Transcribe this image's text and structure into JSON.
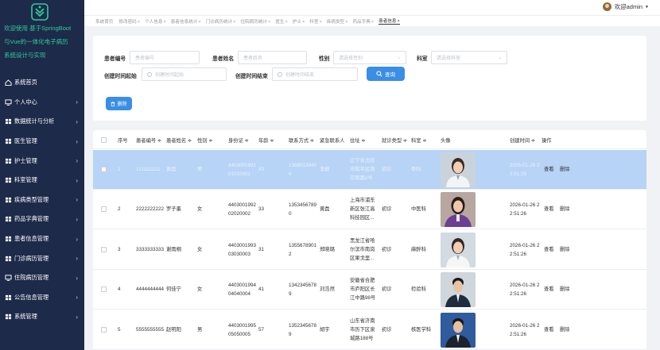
{
  "app": {
    "title_lines": [
      "欢迎使用 基于SpringBoot",
      "与Vue的一体化电子病历",
      "系统设计与实现"
    ]
  },
  "sidebar": {
    "items": [
      {
        "label": "系统首页",
        "icon": "home-icon",
        "arrow": ""
      },
      {
        "label": "个人中心",
        "icon": "monitor-icon",
        "arrow": "›"
      },
      {
        "label": "数据统计与分析",
        "icon": "grid-icon",
        "arrow": "›"
      },
      {
        "label": "医生管理",
        "icon": "grid-icon",
        "arrow": "›"
      },
      {
        "label": "护士管理",
        "icon": "grid-icon",
        "arrow": "›"
      },
      {
        "label": "科室管理",
        "icon": "grid-icon",
        "arrow": "›"
      },
      {
        "label": "疾病类型管理",
        "icon": "grid-icon",
        "arrow": "›"
      },
      {
        "label": "药品字典管理",
        "icon": "grid-icon",
        "arrow": "›"
      },
      {
        "label": "患者信息管理",
        "icon": "grid-icon",
        "arrow": "›"
      },
      {
        "label": "门诊病历管理",
        "icon": "grid-icon",
        "arrow": "›"
      },
      {
        "label": "住院病历管理",
        "icon": "monitor-icon",
        "arrow": "›"
      },
      {
        "label": "公告信息管理",
        "icon": "grid-icon",
        "arrow": "›"
      },
      {
        "label": "系统管理",
        "icon": "grid-icon",
        "arrow": "›"
      }
    ]
  },
  "topbar": {
    "user_label": "欢迎admin",
    "dropdown": "▼"
  },
  "tabs": [
    {
      "label": "系统首页",
      "close": ""
    },
    {
      "label": "修改密码",
      "close": "×"
    },
    {
      "label": "个人信息",
      "close": "×"
    },
    {
      "label": "患者信息统计",
      "close": "×"
    },
    {
      "label": "门诊病历统计",
      "close": "×"
    },
    {
      "label": "住院病历统计",
      "close": "×"
    },
    {
      "label": "医生",
      "close": "×"
    },
    {
      "label": "护士",
      "close": "×"
    },
    {
      "label": "科室",
      "close": "×"
    },
    {
      "label": "疾病类型",
      "close": "×"
    },
    {
      "label": "药品字典",
      "close": "×"
    },
    {
      "label": "患者信息",
      "close": "×"
    }
  ],
  "search": {
    "patient_no_label": "患者编号",
    "patient_no_placeholder": "患者编号",
    "patient_name_label": "患者姓名",
    "patient_name_placeholder": "患者姓名",
    "gender_label": "性别",
    "gender_placeholder": "请选择性别",
    "dept_label": "科室",
    "dept_placeholder": "请选择科室",
    "start_label": "创建时间起始",
    "start_placeholder": "创建时间起始",
    "end_label": "创建时间结束",
    "end_placeholder": "创建时间结束",
    "search_button": "查询",
    "delete_button": "删除"
  },
  "table": {
    "headers": [
      "序号",
      "患者编号 ≑",
      "患者姓名 ≑",
      "性别 ≑",
      "身份证 ≑",
      "年龄 ≑",
      "联系方式 ≑",
      "紧急联系人",
      "住址 ≑",
      "就诊类型 ≑",
      "科室 ≑",
      "头像",
      "创建时间 ≑",
      "操作"
    ],
    "rows": [
      {
        "index": "1",
        "patient_no": "1111111111",
        "name": "黄磊",
        "gender": "男",
        "id_card": [
          "4403001991",
          "01010001"
        ],
        "age": "43",
        "phone": [
          "1368013945",
          "6"
        ],
        "contact": "李静",
        "address": [
          "辽宁省沈阳",
          "市和平区南",
          "京南路2号"
        ],
        "visit_type": "初诊",
        "dept": "骨科",
        "created": [
          "2026-01-26 2",
          "2:51:26"
        ],
        "view": "查看",
        "delete": "删除"
      },
      {
        "index": "2",
        "patient_no": "2222222222",
        "name": "罗子墨",
        "gender": "女",
        "id_card": [
          "4403001992",
          "02020002"
        ],
        "age": "33",
        "phone": [
          "1353456789",
          "0"
        ],
        "contact": "黄磊",
        "address": [
          "上海市浦东",
          "新区张江高",
          "科技园区..."
        ],
        "visit_type": "初诊",
        "dept": "中医科",
        "created": [
          "2026-01-26 2",
          "2:51:26"
        ],
        "view": "查看",
        "delete": "删除"
      },
      {
        "index": "3",
        "patient_no": "3333333333",
        "name": "谢雨桐",
        "gender": "女",
        "id_card": [
          "4403001993",
          "03030003"
        ],
        "age": "31",
        "phone": [
          "1355678901",
          "2"
        ],
        "contact": "郑晓璐",
        "address": [
          "黑龙江省哈",
          "尔滨市南岗",
          "区果戈里..."
        ],
        "visit_type": "初诊",
        "dept": "麻醉科",
        "created": [
          "2026-01-26 2",
          "2:51:26"
        ],
        "view": "查看",
        "delete": "删除"
      },
      {
        "index": "4",
        "patient_no": "4444444444",
        "name": "何佳宁",
        "gender": "女",
        "id_card": [
          "4403001994",
          "04040004"
        ],
        "age": "41",
        "phone": [
          "1342345678",
          "9"
        ],
        "contact": "刘浩然",
        "address": [
          "安徽省合肥",
          "市庐阳区长",
          "江中路98号"
        ],
        "visit_type": "初诊",
        "dept": "检验科",
        "created": [
          "2026-01-26 2",
          "2:51:26"
        ],
        "view": "查看",
        "delete": "删除"
      },
      {
        "index": "5",
        "patient_no": "5555555555",
        "name": "赵明阳",
        "gender": "男",
        "id_card": [
          "4403001995",
          "05050005"
        ],
        "age": "57",
        "phone": [
          "1352345678",
          "9"
        ],
        "contact": "胡宇",
        "address": [
          "山东省济南",
          "市历下区泉",
          "城路188号"
        ],
        "visit_type": "初诊",
        "dept": "核医学科",
        "created": [
          "2026-01-26 2",
          "2:51:26"
        ],
        "view": "查看",
        "delete": "删除"
      }
    ]
  },
  "colors": {
    "sidebar_bg": "#1e2a4a",
    "accent": "#3a8ee6",
    "title_green": "#2ecc9a",
    "selected_row": "#b7d3f5"
  }
}
